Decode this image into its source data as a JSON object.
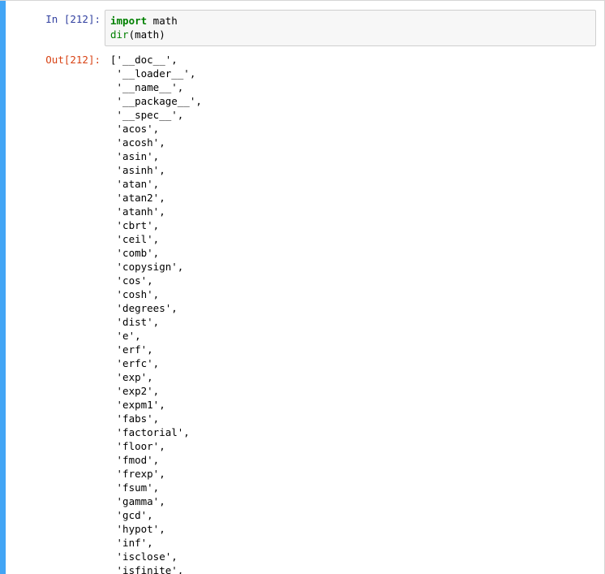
{
  "cell": {
    "in_prompt": "In [212]:",
    "out_prompt": "Out[212]:",
    "code": {
      "line1_keyword": "import",
      "line1_rest": " math",
      "line2_func": "dir",
      "line2_rest": "(math)"
    },
    "output_lines": [
      "['__doc__',",
      " '__loader__',",
      " '__name__',",
      " '__package__',",
      " '__spec__',",
      " 'acos',",
      " 'acosh',",
      " 'asin',",
      " 'asinh',",
      " 'atan',",
      " 'atan2',",
      " 'atanh',",
      " 'cbrt',",
      " 'ceil',",
      " 'comb',",
      " 'copysign',",
      " 'cos',",
      " 'cosh',",
      " 'degrees',",
      " 'dist',",
      " 'e',",
      " 'erf',",
      " 'erfc',",
      " 'exp',",
      " 'exp2',",
      " 'expm1',",
      " 'fabs',",
      " 'factorial',",
      " 'floor',",
      " 'fmod',",
      " 'frexp',",
      " 'fsum',",
      " 'gamma',",
      " 'gcd',",
      " 'hypot',",
      " 'inf',",
      " 'isclose',",
      " 'isfinite',"
    ]
  },
  "colors": {
    "selected_bar": "#42a5f5",
    "in_prompt": "#303f9f",
    "out_prompt": "#d84315",
    "keyword": "#008000"
  }
}
